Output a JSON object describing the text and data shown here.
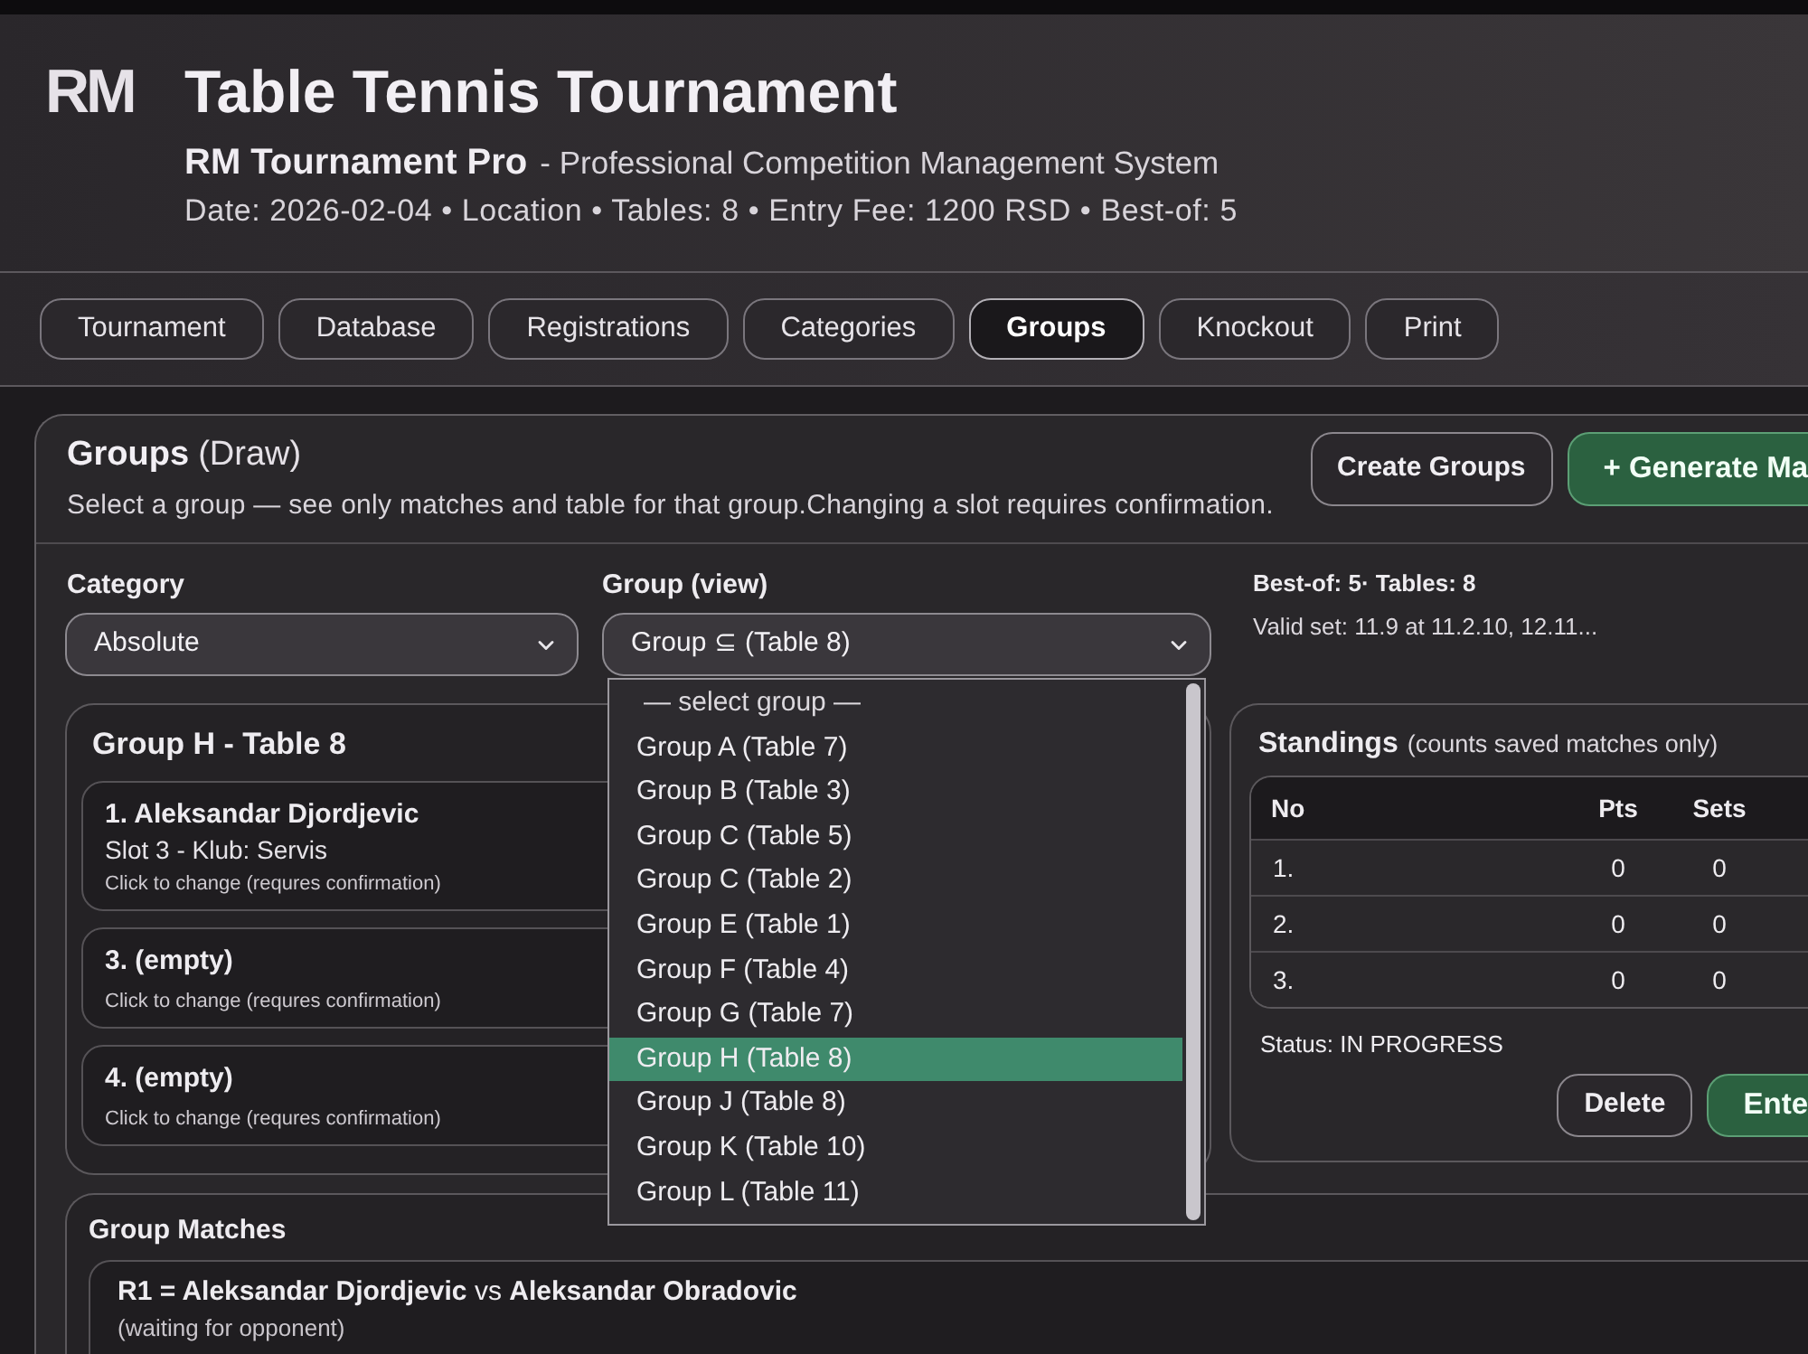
{
  "header": {
    "logo": "RM",
    "title": "Table Tennis Tournament",
    "product": "RM Tournament Pro",
    "tagline": "- Professional Competition Management System",
    "info": "Date: 2026-02-04 • Location • Tables: 8 • Entry Fee: 1200 RSD • Best-of: 5"
  },
  "tabs": [
    {
      "label": "Tournament",
      "selected": false
    },
    {
      "label": "Database",
      "selected": false
    },
    {
      "label": "Registrations",
      "selected": false
    },
    {
      "label": "Categories",
      "selected": false
    },
    {
      "label": "Groups",
      "selected": true
    },
    {
      "label": "Knockout",
      "selected": false
    },
    {
      "label": "Print",
      "selected": false
    }
  ],
  "panel": {
    "title": "Groups",
    "title_note": "(Draw)",
    "description": "Select a group — see only matches and table for that group.Changing a slot requires confirmation.",
    "buttons": [
      {
        "label": "Create Groups",
        "kind": "outline"
      },
      {
        "label": "+ Generate Ma",
        "kind": "primary"
      }
    ]
  },
  "filters": {
    "category": {
      "label": "Category",
      "value": "Absolute"
    },
    "group": {
      "label": "Group (view)",
      "value": "Group ⊆ (Table 8)",
      "expanded": true,
      "options": [
        {
          "label": "— select group —",
          "selected": false
        },
        {
          "label": "Group A (Table 7)",
          "selected": false
        },
        {
          "label": "Group B (Table 3)",
          "selected": false
        },
        {
          "label": "Group C (Table 5)",
          "selected": false
        },
        {
          "label": "Group C (Table 2)",
          "selected": false
        },
        {
          "label": "Group E (Table 1)",
          "selected": false
        },
        {
          "label": "Group F (Table 4)",
          "selected": false
        },
        {
          "label": "Group G (Table 7)",
          "selected": false
        },
        {
          "label": "Group H (Table 8)",
          "selected": true
        },
        {
          "label": "Group J (Table 8)",
          "selected": false
        },
        {
          "label": "Group K (Table 10)",
          "selected": false
        },
        {
          "label": "Group L (Table 11)",
          "selected": false
        }
      ]
    }
  },
  "settings": {
    "summary": "Best-of: 5· Tables: 8",
    "valid_set": "Valid set: 11.9 at 11.2.10, 12.11..."
  },
  "group_card": {
    "title": "Group H - Table 8",
    "slots": [
      {
        "name": "1. Aleksandar Djordjevic",
        "detail": "Slot 3 - Klub: Servis",
        "hint": "Click to change (requres confirmation)"
      },
      {
        "name": "3. (empty)",
        "hint": "Click to change (requres confirmation)"
      },
      {
        "name": "4. (empty)",
        "hint": "Click to change (requres confirmation)"
      }
    ]
  },
  "standings": {
    "title": "Standings",
    "note": "(counts saved matches only)",
    "columns": [
      "No",
      "Pts",
      "Sets"
    ],
    "rows": [
      [
        "1.",
        "0",
        "0"
      ],
      [
        "2.",
        "0",
        "0"
      ],
      [
        "3.",
        "0",
        "0"
      ]
    ],
    "status": "Status: IN PROGRESS",
    "buttons": [
      {
        "label": "Delete",
        "kind": "outline"
      },
      {
        "label": "Ente",
        "kind": "primary"
      }
    ]
  },
  "matches": {
    "title": "Group Matches",
    "items": [
      {
        "text": "**R1 = Aleksandar Djordjevic** vs **Aleksandar Obradovic**",
        "note": "(waiting for opponent)"
      }
    ]
  }
}
